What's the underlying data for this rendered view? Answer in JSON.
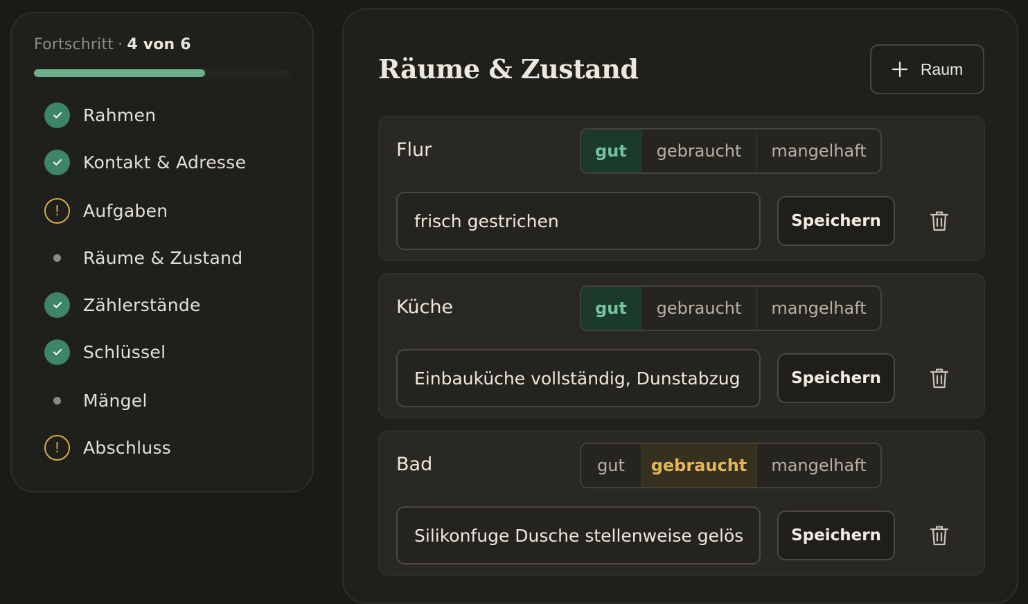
{
  "sidebar": {
    "progress": {
      "label": "Fortschritt",
      "separator": "·",
      "count": "4 von 6",
      "fraction": 0.667,
      "color": "#6bb08a"
    },
    "items": [
      {
        "label": "Rahmen",
        "status": "done",
        "icon": "check-circle-icon"
      },
      {
        "label": "Kontakt & Adresse",
        "status": "done",
        "icon": "check-circle-icon"
      },
      {
        "label": "Aufgaben",
        "status": "warning",
        "icon": "warning-circle-icon"
      },
      {
        "label": "Räume & Zustand",
        "status": "current",
        "icon": "dot-icon"
      },
      {
        "label": "Zählerstände",
        "status": "done",
        "icon": "check-circle-icon"
      },
      {
        "label": "Schlüssel",
        "status": "done",
        "icon": "check-circle-icon"
      },
      {
        "label": "Mängel",
        "status": "pending",
        "icon": "dot-icon"
      },
      {
        "label": "Abschluss",
        "status": "warning",
        "icon": "warning-circle-icon"
      }
    ]
  },
  "main": {
    "title": "Räume & Zustand",
    "add_room_label": "Raum",
    "condition_options": [
      "gut",
      "gebraucht",
      "mangelhaft"
    ],
    "rooms": [
      {
        "name": "Flur",
        "condition": "gut",
        "note": "frisch gestrichen",
        "save_label": "Speichern"
      },
      {
        "name": "Küche",
        "condition": "gut",
        "note": "Einbauküche vollständig, Dunstabzug gereinigt",
        "save_label": "Speichern"
      },
      {
        "name": "Bad",
        "condition": "gebraucht",
        "note": "Silikonfuge Dusche stellenweise gelöst",
        "save_label": "Speichern"
      }
    ]
  },
  "colors": {
    "accent_green": "#3d8566",
    "warning": "#d8ad4f",
    "selected_good": "#73c59d",
    "selected_used": "#e3b758"
  }
}
